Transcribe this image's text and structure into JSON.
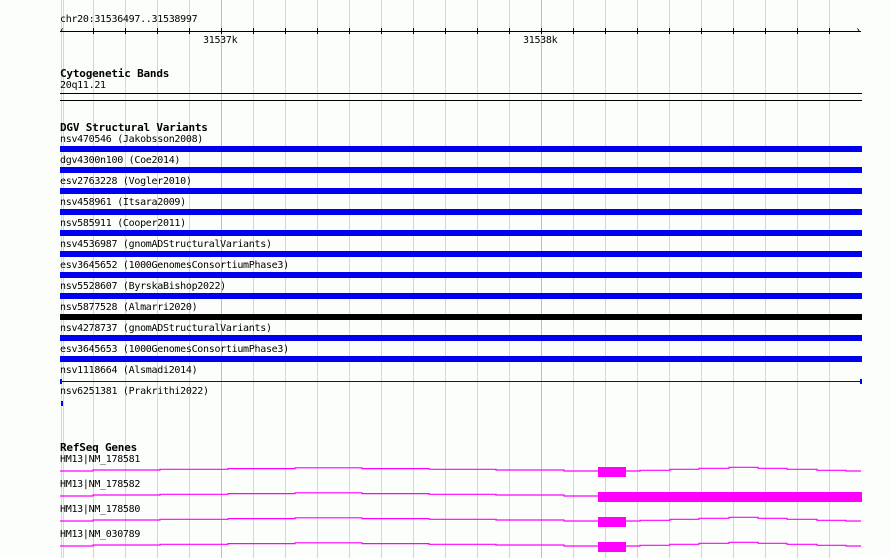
{
  "ruler": {
    "location": "chr20:31536497..31538997",
    "major_ticks": [
      "31537k",
      "31538k"
    ]
  },
  "cytobands": {
    "title": "Cytogenetic Bands",
    "band": "20q11.21"
  },
  "dgv": {
    "title": "DGV Structural Variants",
    "items": [
      {
        "label": "nsv470546 (Jakobsson2008)",
        "color": "#0000ee",
        "style": "bar"
      },
      {
        "label": "dgv4300n100 (Coe2014)",
        "color": "#0000ee",
        "style": "bar"
      },
      {
        "label": "esv2763228 (Vogler2010)",
        "color": "#0000ee",
        "style": "bar"
      },
      {
        "label": "nsv458961 (Itsara2009)",
        "color": "#0000ee",
        "style": "bar"
      },
      {
        "label": "nsv585911 (Cooper2011)",
        "color": "#0000ee",
        "style": "bar"
      },
      {
        "label": "nsv4536987 (gnomADStructuralVariants)",
        "color": "#0000ee",
        "style": "bar"
      },
      {
        "label": "esv3645652 (1000GenomesConsortiumPhase3)",
        "color": "#0000ee",
        "style": "bar"
      },
      {
        "label": "nsv5528607 (ByrskaBishop2022)",
        "color": "#0000ee",
        "style": "bar"
      },
      {
        "label": "nsv5877528 (Almarri2020)",
        "color": "#000000",
        "style": "bar"
      },
      {
        "label": "nsv4278737 (gnomADStructuralVariants)",
        "color": "#0000ee",
        "style": "bar"
      },
      {
        "label": "esv3645653 (1000GenomesConsortiumPhase3)",
        "color": "#0000ee",
        "style": "bar"
      },
      {
        "label": "nsv1118664 (Alsmadi2014)",
        "color": "#0000ee",
        "style": "line"
      },
      {
        "label": "nsv6251381 (Prakrithi2022)",
        "color": "#0000ee",
        "style": "tick"
      }
    ]
  },
  "refseq": {
    "title": "RefSeq Genes",
    "color": "#ff00ff",
    "genes": [
      {
        "label": "HM13|NM_178581",
        "exon": "short"
      },
      {
        "label": "HM13|NM_178582",
        "exon": "long"
      },
      {
        "label": "HM13|NM_178580",
        "exon": "short"
      },
      {
        "label": "HM13|NM_030789",
        "exon": "short"
      }
    ]
  }
}
